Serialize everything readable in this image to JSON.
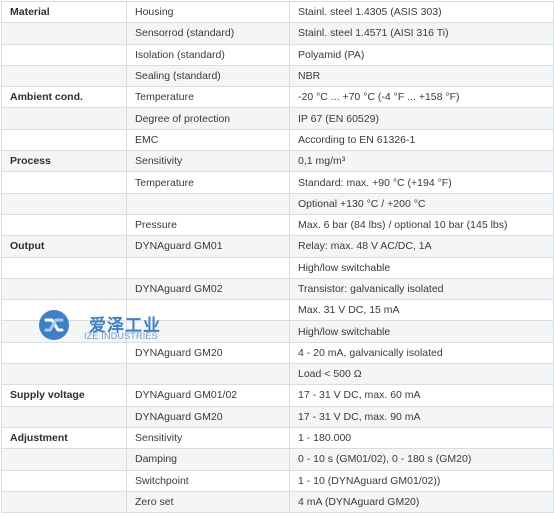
{
  "rows": [
    {
      "group": "Material",
      "label": "Housing",
      "value": "Stainl. steel 1.4305 (ASIS 303)"
    },
    {
      "group": "",
      "label": "Sensorrod (standard)",
      "value": "Stainl. steel 1.4571 (AISI 316 Ti)"
    },
    {
      "group": "",
      "label": "Isolation (standard)",
      "value": "Polyamid (PA)"
    },
    {
      "group": "",
      "label": "Sealing (standard)",
      "value": "NBR"
    },
    {
      "group": "Ambient cond.",
      "label": "Temperature",
      "value": "-20 °C ... +70 °C (-4 °F ... +158 °F)"
    },
    {
      "group": "",
      "label": "Degree of protection",
      "value": "IP 67 (EN 60529)"
    },
    {
      "group": "",
      "label": "EMC",
      "value": "According to  EN 61326-1"
    },
    {
      "group": "Process",
      "label": "Sensitivity",
      "value": "0,1 mg/m³"
    },
    {
      "group": "",
      "label": "Temperature",
      "value": "Standard: max. +90 °C (+194 °F)"
    },
    {
      "group": "",
      "label": "",
      "value": "Optional +130 °C / +200 °C"
    },
    {
      "group": "",
      "label": "Pressure",
      "value": "Max. 6 bar (84 lbs) / optional 10 bar (145 lbs)"
    },
    {
      "group": "Output",
      "label": "DYNAguard GM01",
      "value": "Relay: max. 48 V AC/DC, 1A"
    },
    {
      "group": "",
      "label": "",
      "value": "High/low switchable"
    },
    {
      "group": "",
      "label": "DYNAguard GM02",
      "value": "Transistor: galvanically isolated"
    },
    {
      "group": "",
      "label": "",
      "value": "Max. 31 V DC, 15 mA"
    },
    {
      "group": "",
      "label": "",
      "value": "High/low switchable"
    },
    {
      "group": "",
      "label": "DYNAguard GM20",
      "value": "4 - 20 mA, galvanically isolated"
    },
    {
      "group": "",
      "label": "",
      "value": "Load < 500 Ω"
    },
    {
      "group": "Supply voltage",
      "label": "DYNAguard GM01/02",
      "value": "17 - 31 V DC, max. 60 mA"
    },
    {
      "group": "",
      "label": "DYNAguard GM20",
      "value": "17 - 31 V DC, max. 90 mA"
    },
    {
      "group": "Adjustment",
      "label": "Sensitivity",
      "value": "1 - 180.000"
    },
    {
      "group": "",
      "label": "Damping",
      "value": "0 - 10 s (GM01/02), 0 - 180 s (GM20)"
    },
    {
      "group": "",
      "label": "Switchpoint",
      "value": "1 - 10 (DYNAguard GM01/02))"
    },
    {
      "group": "",
      "label": "Zero set",
      "value": "4 mA (DYNAguard GM20)"
    }
  ],
  "watermark": {
    "chinese_text": "爱泽工业",
    "english_text": "IZE INDUSTRIES",
    "color": "#2b73c4"
  }
}
